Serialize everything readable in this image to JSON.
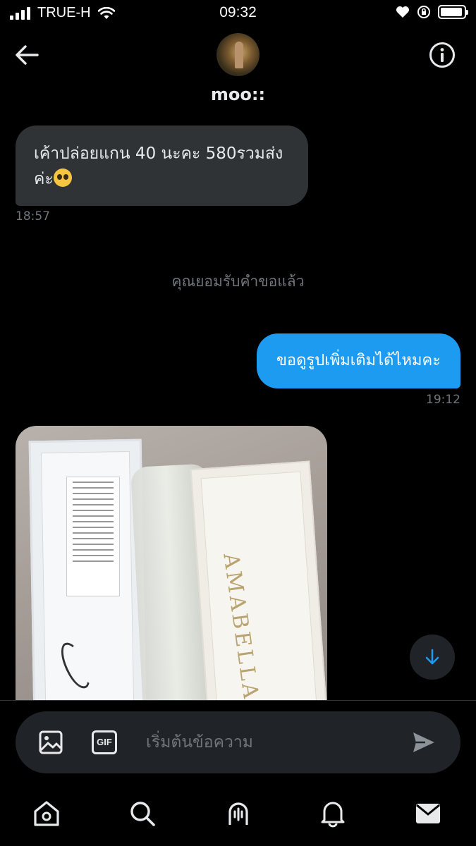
{
  "status_bar": {
    "carrier": "TRUE-H",
    "time": "09:32",
    "battery_level": 0.95
  },
  "header": {
    "contact_name": "moo::",
    "icons": [
      "back-arrow-icon",
      "info-icon"
    ]
  },
  "messages": {
    "incoming": {
      "text": "เค้าปล่อยแกน 40 นะคะ 580รวมส่งค่ะ",
      "emoji": "pleading-face",
      "timestamp": "18:57"
    },
    "system": "คุณยอมรับคำขอแล้ว",
    "outgoing": {
      "text": "ขอดูรูปเพิ่มเติมได้ไหมคะ",
      "timestamp": "19:12"
    },
    "photo": {
      "brand_text": "AMABELLA"
    }
  },
  "composer": {
    "gif_label": "GIF",
    "placeholder": "เริ่มต้นข้อความ"
  },
  "bottom_nav": {
    "items": [
      "home-icon",
      "search-icon",
      "spaces-icon",
      "notifications-icon",
      "messages-icon"
    ]
  },
  "colors": {
    "background": "#000000",
    "incoming_bubble": "#2f3336",
    "outgoing_bubble": "#1d9bf0",
    "muted_text": "#71767b",
    "accent": "#1d9bf0"
  }
}
